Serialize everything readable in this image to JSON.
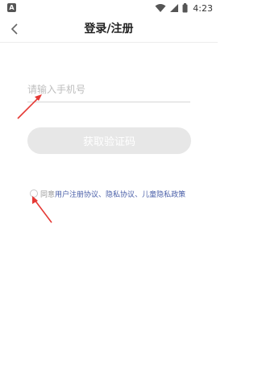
{
  "status_bar": {
    "left_badge": "A",
    "time": "4:23",
    "icons": [
      "wifi-icon",
      "signal-icon",
      "battery-icon"
    ]
  },
  "header": {
    "title": "登录/注册",
    "back_icon": "chevron-left-icon"
  },
  "form": {
    "phone_placeholder": "请输入手机号",
    "phone_value": "",
    "get_code_label": "获取验证码",
    "button_color": "#e7e7e7"
  },
  "agreement": {
    "checked": false,
    "prefix": "同意",
    "link_user": "用户注册协议",
    "sep1": "、",
    "link_privacy": "隐私协议",
    "sep2": "、",
    "link_child": "儿童隐私政策",
    "link_color": "#4a5fa8"
  },
  "annotations": {
    "arrow_color": "#e53935"
  }
}
